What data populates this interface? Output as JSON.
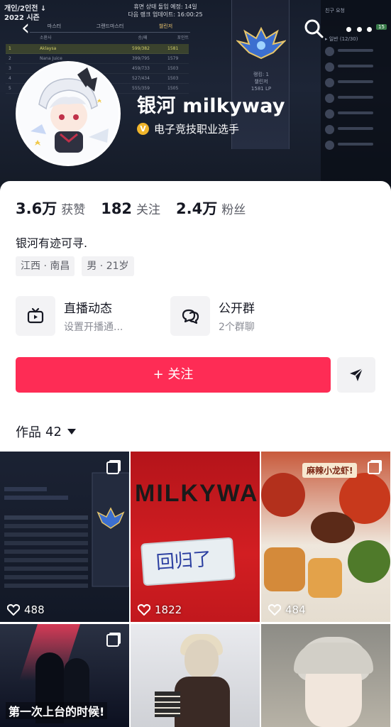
{
  "banner": {
    "season_line1": "개인/2인전 ↓",
    "season_line2": "2022 시즌",
    "rank_line1": "휴면 상태 돌입 예정: 14일",
    "rank_line2": "다음 랭크 업데이트: 16:00:25",
    "tabs": [
      "마스터",
      "그랜드마스터",
      "챌린저"
    ],
    "headers": [
      "소환사",
      "승/패",
      "포인트"
    ],
    "rows": [
      {
        "rank": "1",
        "name": "Aklaysa",
        "wl": "599/382",
        "lp": "1581"
      },
      {
        "rank": "2",
        "name": "Nana Juice",
        "wl": "399/795",
        "lp": "1579"
      },
      {
        "rank": "3",
        "name": "",
        "wl": "459/733",
        "lp": "1503"
      },
      {
        "rank": "4",
        "name": "",
        "wl": "527/434",
        "lp": "1503"
      },
      {
        "rank": "5",
        "name": "",
        "wl": "555/359",
        "lp": "1505"
      }
    ],
    "emblem_line1": "랭킹: 1",
    "emblem_line2": "챌린저",
    "emblem_line3": "1581 LP",
    "friends_title": "친구 요청",
    "friends_group": "▸ 일반 (12/30)",
    "friends_badge": "15"
  },
  "header": {
    "back_icon": "‹"
  },
  "profile": {
    "name": "银河 milkyway",
    "verify_letter": "V",
    "verify_text": "电子竞技职业选手"
  },
  "stats": [
    {
      "value": "3.6万",
      "label": "获赞"
    },
    {
      "value": "182",
      "label": "关注"
    },
    {
      "value": "2.4万",
      "label": "粉丝"
    }
  ],
  "bio": "银河有迹可寻.",
  "tags": [
    "江西 · 南昌",
    "男 · 21岁"
  ],
  "entries": {
    "live": {
      "title": "直播动态",
      "subtitle": "设置开播通..."
    },
    "group": {
      "title": "公开群",
      "subtitle": "2个群聊"
    }
  },
  "follow_label": "+ 关注",
  "works": {
    "label": "作品",
    "count": "42"
  },
  "videos": [
    {
      "likes": "488",
      "caption": "",
      "tshirt": "",
      "note": ""
    },
    {
      "likes": "1822",
      "caption": "",
      "tshirt": "MILKYWA",
      "note": "回归了"
    },
    {
      "likes": "484",
      "caption": "麻辣小龙虾!",
      "tshirt": "",
      "note": ""
    },
    {
      "likes": "",
      "caption": "第一次上台的时候!",
      "tshirt": "",
      "note": ""
    },
    {
      "likes": "",
      "caption": "",
      "tshirt": "",
      "note": ""
    },
    {
      "likes": "",
      "caption": "",
      "tshirt": "",
      "note": ""
    }
  ],
  "colors": {
    "accent": "#fe2c55",
    "verify": "#f0b52b",
    "banner": "#1d2536"
  }
}
